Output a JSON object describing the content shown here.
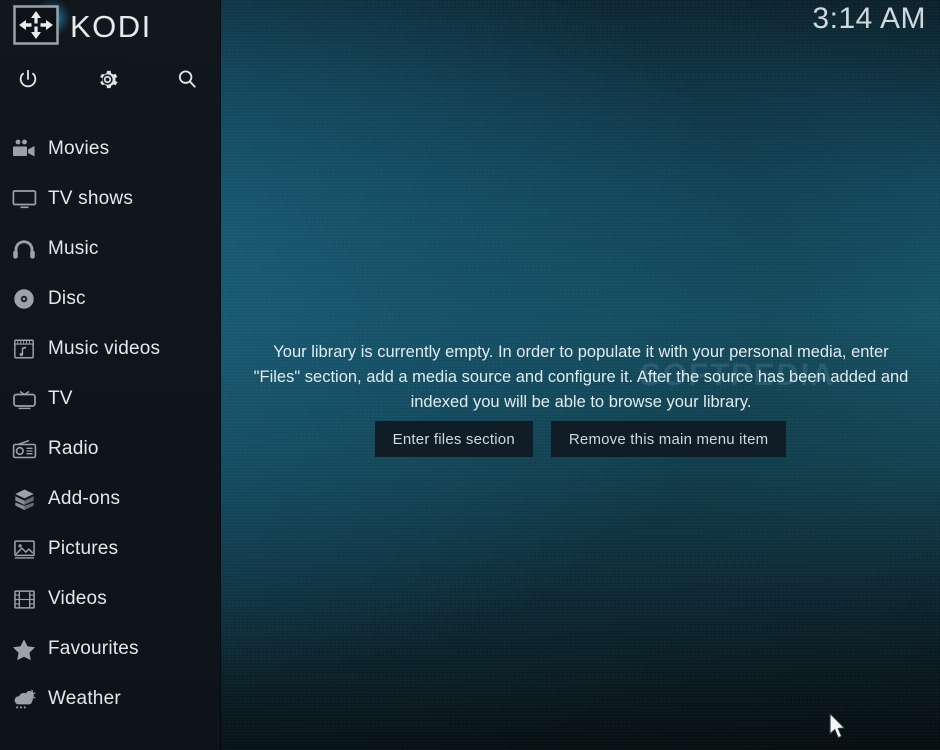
{
  "brand": {
    "name": "KODI",
    "logo_icon": "kodi-move-arrows-icon"
  },
  "clock": {
    "time": "3:14 AM"
  },
  "quick_actions": [
    {
      "name": "power",
      "label": "Power",
      "icon": "power-icon"
    },
    {
      "name": "settings",
      "label": "Settings",
      "icon": "gear-icon"
    },
    {
      "name": "search",
      "label": "Search",
      "icon": "search-icon"
    }
  ],
  "sidebar": {
    "items": [
      {
        "label": "Movies",
        "icon": "movie-camera-icon"
      },
      {
        "label": "TV shows",
        "icon": "monitor-icon"
      },
      {
        "label": "Music",
        "icon": "headphones-icon"
      },
      {
        "label": "Disc",
        "icon": "disc-icon"
      },
      {
        "label": "Music videos",
        "icon": "music-video-icon"
      },
      {
        "label": "TV",
        "icon": "television-icon"
      },
      {
        "label": "Radio",
        "icon": "radio-icon"
      },
      {
        "label": "Add-ons",
        "icon": "package-box-icon"
      },
      {
        "label": "Pictures",
        "icon": "picture-icon"
      },
      {
        "label": "Videos",
        "icon": "film-strip-icon"
      },
      {
        "label": "Favourites",
        "icon": "star-icon"
      },
      {
        "label": "Weather",
        "icon": "weather-cloud-icon"
      }
    ]
  },
  "main": {
    "empty_message": "Your library is currently empty. In order to populate it with your personal media, enter \"Files\" section, add a media source and configure it. After the source has been added and indexed you will be able to browse your library.",
    "buttons": [
      {
        "label": "Enter files section"
      },
      {
        "label": "Remove this main menu item"
      }
    ],
    "watermark": "SOFTPEDIA"
  },
  "colors": {
    "sidebar_bg": "#10161c",
    "accent_teal": "#17536b",
    "text_primary": "#e4e8ea",
    "button_bg": "#101d26",
    "logo_glow": "#3cafe6"
  }
}
